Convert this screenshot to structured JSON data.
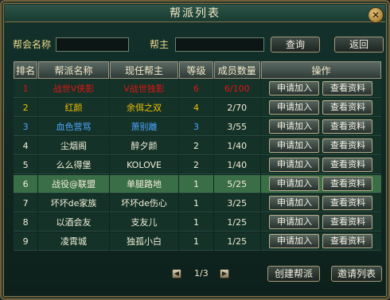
{
  "window": {
    "title": "帮派列表",
    "close_icon": "close-icon"
  },
  "search": {
    "guild_name_label": "帮会名称",
    "guild_name_value": "",
    "leader_label": "帮主",
    "leader_value": "",
    "query_label": "查询",
    "back_label": "返回"
  },
  "table": {
    "headers": [
      "排名",
      "帮派名称",
      "现任帮主",
      "等级",
      "成员数量",
      "操作"
    ],
    "join_label": "申请加入",
    "view_label": "查看资料",
    "rows": [
      {
        "rank": "1",
        "name": "战世V侠影",
        "leader": "V战世独影",
        "level": "6",
        "members": "6/100",
        "color": "#e01414"
      },
      {
        "rank": "2",
        "name": "红颜",
        "leader": "余佴之双",
        "level": "4",
        "members": "2/70",
        "color": "#f0c000"
      },
      {
        "rank": "3",
        "name": "血色营骂",
        "leader": "萧别離",
        "level": "3",
        "members": "3/55",
        "color": "#4da6ff"
      },
      {
        "rank": "4",
        "name": "尘烟阁",
        "leader": "醉夕颜",
        "level": "2",
        "members": "1/40",
        "color": "#f4efd8"
      },
      {
        "rank": "5",
        "name": "么么得堡",
        "leader": "KOLOVE",
        "level": "2",
        "members": "1/40",
        "color": "#f4efd8"
      },
      {
        "rank": "6",
        "name": "战役@联盟",
        "leader": "单腿路地",
        "level": "1",
        "members": "5/25",
        "color": "#f4efd8"
      },
      {
        "rank": "7",
        "name": "坏坏de家族",
        "leader": "坏坏de伤心",
        "level": "1",
        "members": "3/25",
        "color": "#f4efd8"
      },
      {
        "rank": "8",
        "name": "以酒会友",
        "leader": "支友儿",
        "level": "1",
        "members": "1/25",
        "color": "#f4efd8"
      },
      {
        "rank": "9",
        "name": "凌霄城",
        "leader": "独孤小白",
        "level": "1",
        "members": "1/25",
        "color": "#f4efd8"
      }
    ],
    "selected_rank": "6"
  },
  "pager": {
    "page": "1/3",
    "prev_icon": "prev-page-icon",
    "next_icon": "next-page-icon"
  },
  "footer": {
    "create_label": "创建帮派",
    "invite_label": "邀请列表"
  }
}
